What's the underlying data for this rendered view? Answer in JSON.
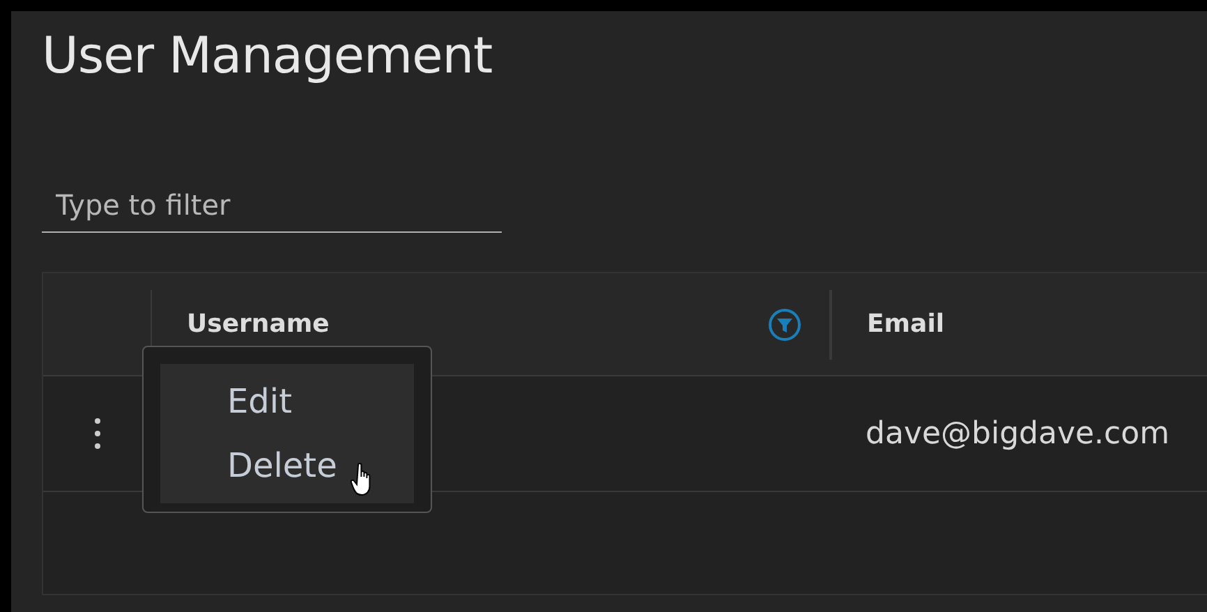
{
  "title": "User Management",
  "filter": {
    "placeholder": "Type to filter"
  },
  "table": {
    "columns": [
      {
        "label": "Username",
        "filter": true
      },
      {
        "label": "Email",
        "filter": false
      }
    ],
    "rows": [
      {
        "username": "",
        "email": "dave@bigdave.com"
      }
    ]
  },
  "row_menu": {
    "items": [
      "Edit",
      "Delete"
    ]
  }
}
